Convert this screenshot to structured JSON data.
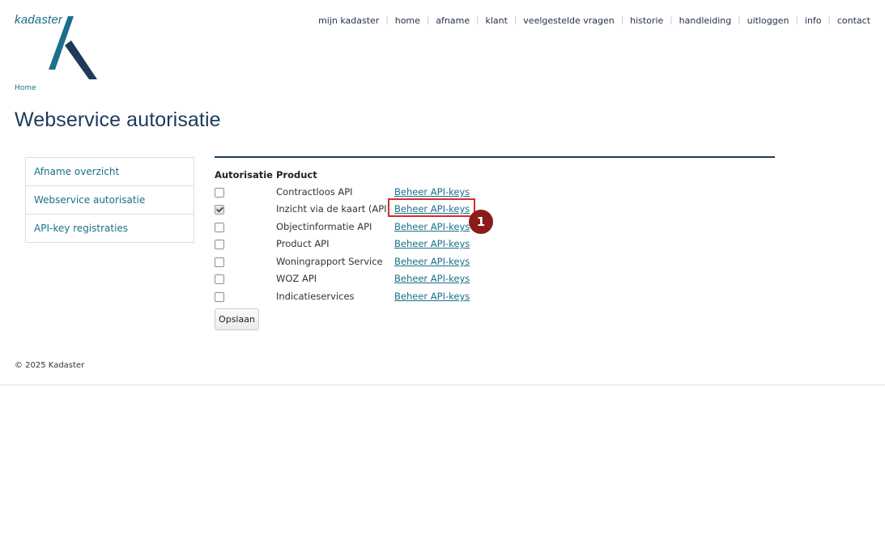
{
  "brand": {
    "logo_text": "kadaster",
    "accent": "#1a6f8a",
    "dark": "#1f3a5a"
  },
  "topnav": [
    {
      "label": "mijn kadaster"
    },
    {
      "label": "home"
    },
    {
      "label": "afname"
    },
    {
      "label": "klant"
    },
    {
      "label": "veelgestelde vragen"
    },
    {
      "label": "historie"
    },
    {
      "label": "handleiding"
    },
    {
      "label": "uitloggen"
    },
    {
      "label": "info"
    },
    {
      "label": "contact"
    }
  ],
  "breadcrumb": "Home",
  "page_title": "Webservice autorisatie",
  "sidebar": {
    "items": [
      {
        "label": "Afname overzicht"
      },
      {
        "label": "Webservice autorisatie"
      },
      {
        "label": "API-key registraties"
      }
    ]
  },
  "table": {
    "headers": {
      "authorization": "Autorisatie",
      "product": "Product"
    },
    "link_label": "Beheer API-keys",
    "rows": [
      {
        "product": "Contractloos API",
        "checked": false,
        "link": "Beheer API-keys"
      },
      {
        "product": "Inzicht via de kaart (API)",
        "checked": true,
        "link": "Beheer API-keys"
      },
      {
        "product": "Objectinformatie API",
        "checked": false,
        "link": "Beheer API-keys"
      },
      {
        "product": "Product API",
        "checked": false,
        "link": "Beheer API-keys"
      },
      {
        "product": "Woningrapport Service",
        "checked": false,
        "link": "Beheer API-keys"
      },
      {
        "product": "WOZ API",
        "checked": false,
        "link": "Beheer API-keys"
      },
      {
        "product": "Indicatieservices",
        "checked": false,
        "link": "Beheer API-keys"
      }
    ]
  },
  "save_label": "Opslaan",
  "annotation": {
    "step": "1",
    "color": "#8c1c1c",
    "box_color": "#d22d2d"
  },
  "footer": "© 2025 Kadaster"
}
